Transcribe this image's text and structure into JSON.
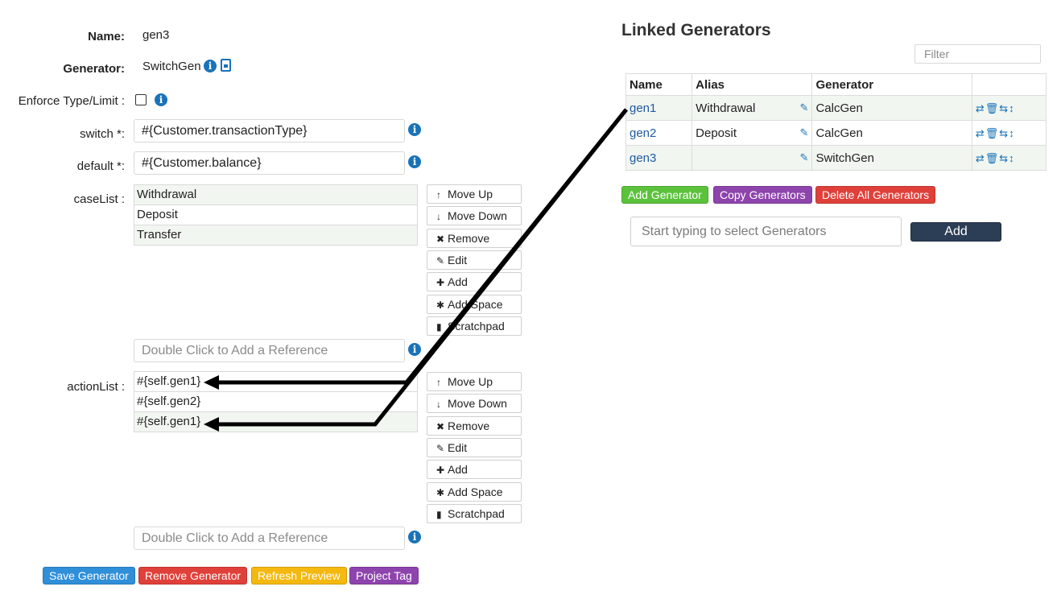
{
  "form": {
    "name_label": "Name:",
    "name_value": "gen3",
    "generator_label": "Generator:",
    "generator_value": "SwitchGen",
    "enforce_label": "Enforce Type/Limit :",
    "switch_label": "switch *:",
    "switch_value": "#{Customer.transactionType}",
    "default_label": "default *:",
    "default_value": "#{Customer.balance}",
    "caselist_label": "caseList :",
    "caselist_items": [
      "Withdrawal",
      "Deposit",
      "Transfer"
    ],
    "caselist_placeholder": "Double Click to Add a Reference",
    "actionlist_label": "actionList :",
    "actionlist_items": [
      "#{self.gen1}",
      "#{self.gen2}",
      "#{self.gen1}"
    ],
    "actionlist_placeholder": "Double Click to Add a Reference"
  },
  "list_buttons": {
    "move_up": "Move Up",
    "move_down": "Move Down",
    "remove": "Remove",
    "edit": "Edit",
    "add": "Add",
    "add_space": "Add Space",
    "scratchpad": "Scratchpad"
  },
  "bottom_buttons": {
    "save": "Save Generator",
    "remove": "Remove Generator",
    "refresh": "Refresh Preview",
    "project_tag": "Project Tag"
  },
  "linked": {
    "title": "Linked Generators",
    "filter_placeholder": "Filter",
    "columns": [
      "Name",
      "Alias",
      "Generator",
      ""
    ],
    "rows": [
      {
        "name": "gen1",
        "alias": "Withdrawal",
        "generator": "CalcGen"
      },
      {
        "name": "gen2",
        "alias": "Deposit",
        "generator": "CalcGen"
      },
      {
        "name": "gen3",
        "alias": "",
        "generator": "SwitchGen"
      }
    ],
    "add_generator": "Add Generator",
    "copy_generators": "Copy Generators",
    "delete_all": "Delete All Generators",
    "select_placeholder": "Start typing to select Generators",
    "add_button": "Add"
  },
  "colors": {
    "info_blue": "#1a73b8",
    "save_blue": "#2f8fd8",
    "remove_red": "#e0403a",
    "refresh_yellow": "#f5b80f",
    "purple": "#8e44ad",
    "green": "#5cc23c",
    "dark_navy": "#2c3e55"
  }
}
